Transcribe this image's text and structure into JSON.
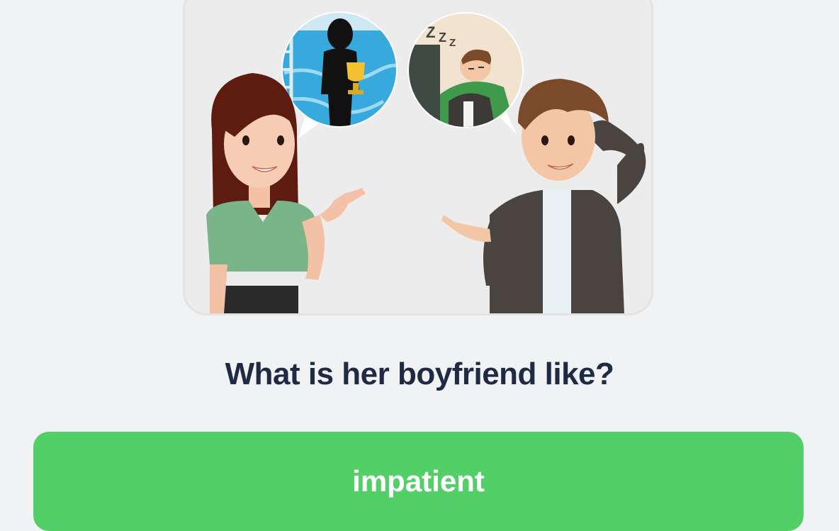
{
  "illustration": {
    "description_icon": "conversation-illustration"
  },
  "question": {
    "text": "What is her boyfriend like?"
  },
  "answer": {
    "label": "impatient"
  },
  "colors": {
    "background": "#f1f2f4",
    "card": "#ececec",
    "question_text": "#1f2a44",
    "answer_button": "#53cf68",
    "answer_text": "#ffffff"
  }
}
